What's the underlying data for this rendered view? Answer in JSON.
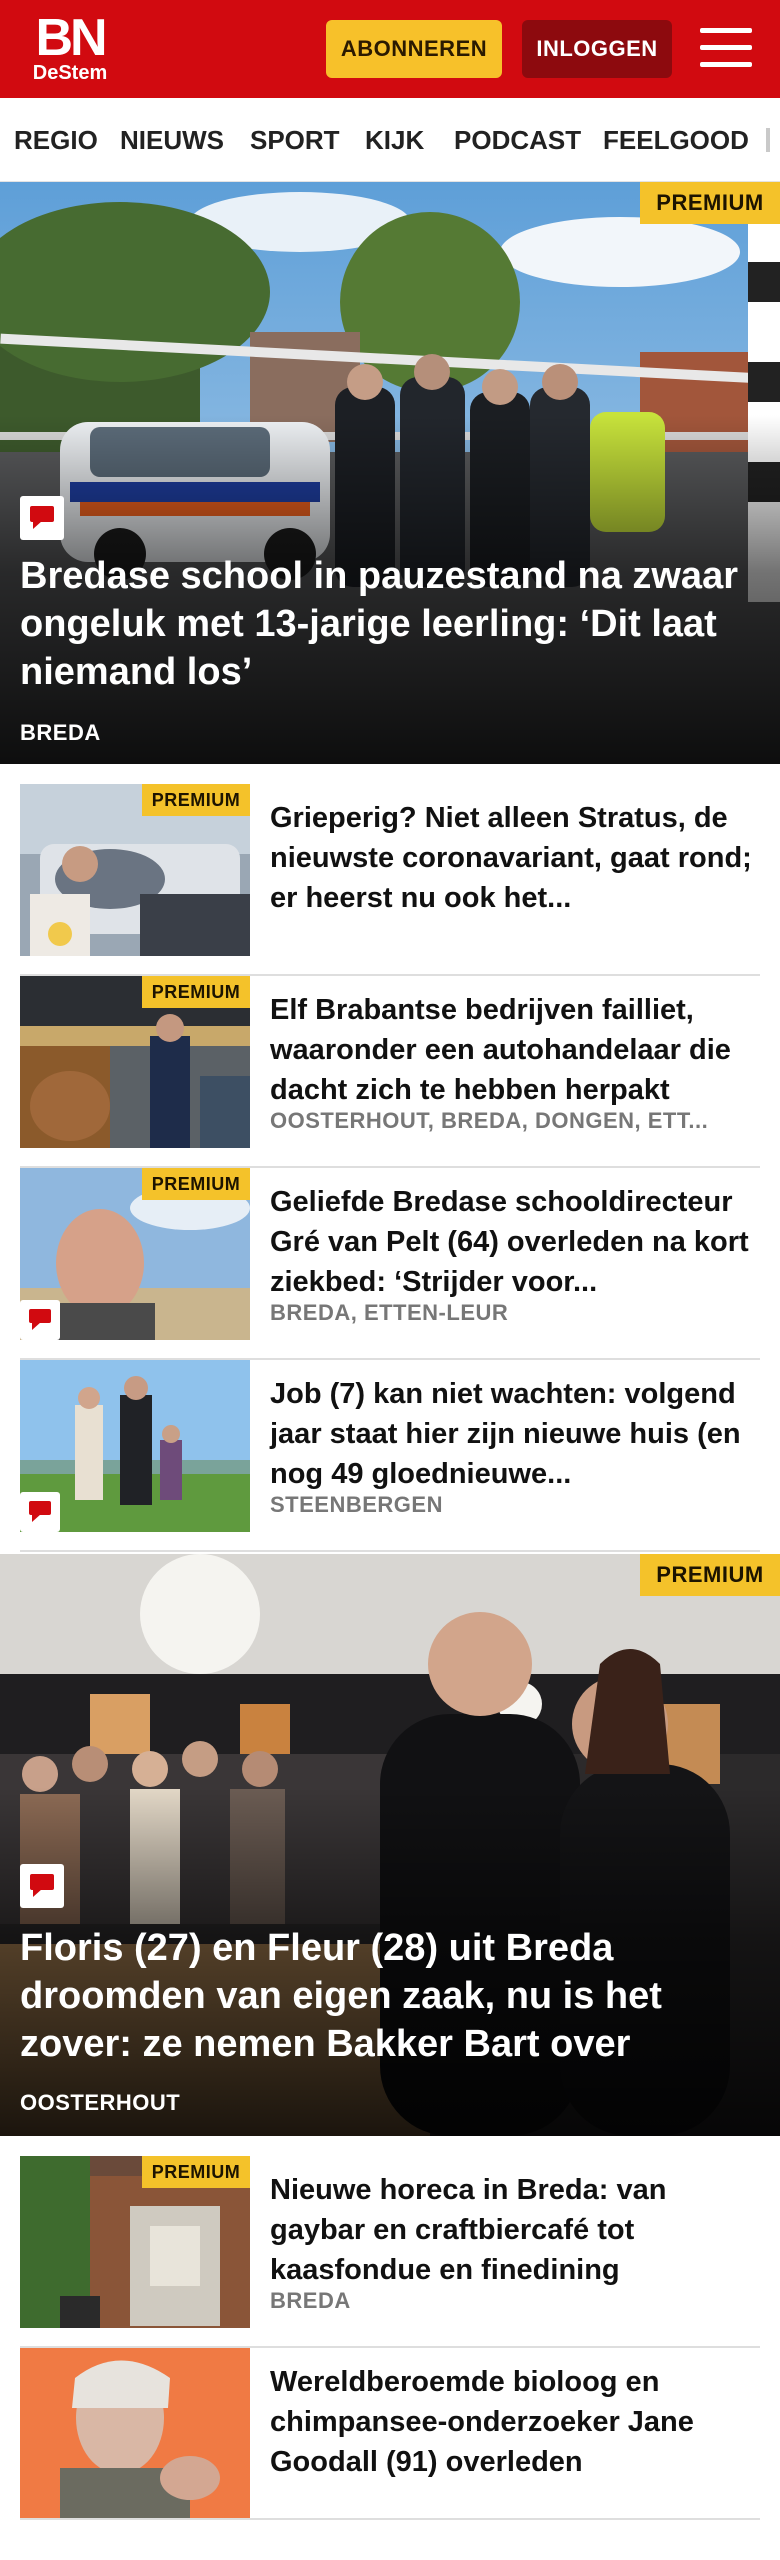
{
  "header": {
    "logo_main": "BN",
    "logo_sub": "DeStem",
    "subscribe_label": "ABONNEREN",
    "login_label": "INLOGGEN",
    "menu_icon": "hamburger-menu-icon",
    "brand_color": "#d10a10",
    "accent_color": "#f7c12a"
  },
  "nav": {
    "items": [
      "REGIO",
      "NIEUWS",
      "SPORT",
      "KIJK",
      "PODCAST",
      "FEELGOOD"
    ]
  },
  "badges": {
    "premium": "PREMIUM"
  },
  "articles": {
    "hero1": {
      "title": "Bredase school in pauzestand na zwaar ongeluk met 13-jarige leerling: ‘Dit laat niemand los’",
      "category": "BREDA",
      "premium": true,
      "comments_icon": "comment-icon"
    },
    "list1": [
      {
        "title": "Grieperig? Niet alleen Stratus, de nieuwste coronavariant, gaat rond; er heerst nu ook het...",
        "category": "",
        "premium": true
      },
      {
        "title": "Elf Brabantse bedrijven failliet, waaronder een autohandelaar die dacht zich te hebben herpakt",
        "category": "OOSTERHOUT, BREDA, DONGEN, ETT...",
        "premium": true
      },
      {
        "title": "Geliefde Bredase schooldirec­teur Gré van Pelt (64) overleden na kort ziekbed: ‘Strijder voor...",
        "category": "BREDA, ETTEN-LEUR",
        "premium": true
      },
      {
        "title": "Job (7) kan niet wachten: volgend jaar staat hier zijn nieuwe huis (en nog 49 gloednieuwe...",
        "category": "STEENBERGEN",
        "premium": false
      }
    ],
    "hero2": {
      "title": "Floris (27) en Fleur (28) uit Breda droomden van eigen zaak, nu is het zover: ze nemen Bakker Bart over",
      "category": "OOSTERHOUT",
      "premium": true
    },
    "list2": [
      {
        "title": "Nieuwe horeca in Breda: van gaybar en craftbiercafé tot kaasfondue en finedining",
        "category": "BREDA",
        "premium": true
      },
      {
        "title": "Wereldberoemde bioloog en chimpansee-onderzoeker Jane Goodall (91) overleden",
        "category": "",
        "premium": false
      }
    ]
  }
}
